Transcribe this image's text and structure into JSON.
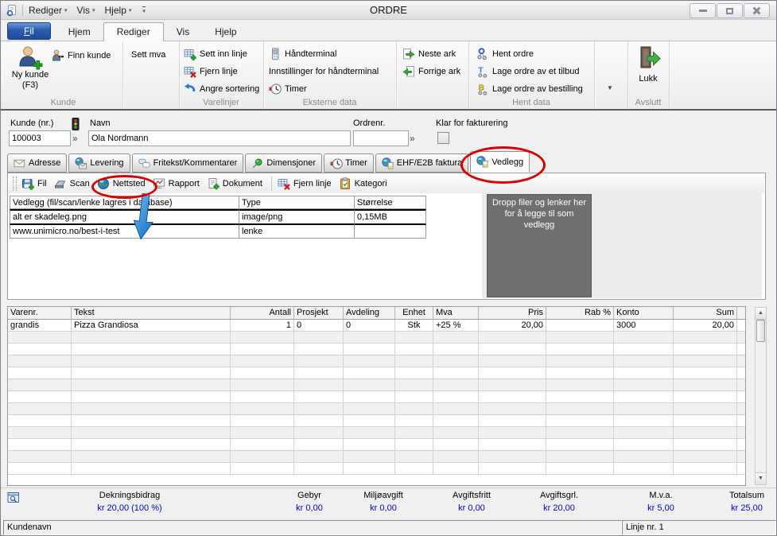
{
  "window": {
    "title": "ORDRE",
    "menu": [
      "Rediger",
      "Vis",
      "Hjelp"
    ]
  },
  "ribbon_tabs": [
    {
      "label": "Fil",
      "file": true
    },
    {
      "label": "Hjem"
    },
    {
      "label": "Rediger",
      "active": true
    },
    {
      "label": "Vis"
    },
    {
      "label": "Hjelp"
    }
  ],
  "ribbon": {
    "kunde": {
      "group_label": "Kunde",
      "new_customer": "Ny kunde",
      "new_customer_sub": "(F3)",
      "find_customer": "Finn kunde"
    },
    "mva": {
      "set_mva": "Sett mva"
    },
    "varelinjer": {
      "group_label": "Varelinjer",
      "insert_line": "Sett inn linje",
      "remove_line": "Fjern linje",
      "undo_sort": "Angre sortering"
    },
    "eksterne": {
      "group_label": "Eksterne data",
      "handheld": "Håndterminal",
      "handheld_settings": "Innstillinger for håndterminal",
      "timer": "Timer"
    },
    "ark": {
      "next": "Neste ark",
      "prev": "Forrige ark"
    },
    "hent": {
      "group_label": "Hent data",
      "get_order": "Hent ordre",
      "from_quote": "Lage ordre av et tilbud",
      "from_order": "Lage ordre av bestilling"
    },
    "avslutt": {
      "group_label": "Avslutt",
      "close": "Lukk"
    }
  },
  "form": {
    "customer_no_label": "Kunde (nr.)",
    "customer_no": "100003",
    "name_label": "Navn",
    "name": "Ola Nordmann",
    "order_no_label": "Ordrenr.",
    "order_no": "",
    "ready_label": "Klar for fakturering",
    "ready_checked": false,
    "lookup_glyph": "»"
  },
  "detail_tabs": [
    {
      "label": "Adresse",
      "icon": "envelope"
    },
    {
      "label": "Levering",
      "icon": "globe_env"
    },
    {
      "label": "Fritekst/Kommentarer",
      "icon": "speech"
    },
    {
      "label": "Dimensjoner",
      "icon": "pin"
    },
    {
      "label": "Timer",
      "icon": "clock"
    },
    {
      "label": "EHF/E2B faktura",
      "icon": "globe_page"
    },
    {
      "label": "Vedlegg",
      "icon": "globe_page",
      "active": true,
      "annotated": true
    }
  ],
  "attachments": {
    "toolbar": [
      {
        "label": "Fil",
        "icon": "disk_plus"
      },
      {
        "label": "Scan",
        "icon": "scanner"
      },
      {
        "label": "Nettsted",
        "icon": "globe",
        "annotated": true
      },
      {
        "label": "Rapport",
        "icon": "report"
      },
      {
        "label": "Dokument",
        "icon": "doc_plus"
      },
      {
        "label": "Fjern linje",
        "icon": "grid_x",
        "sep": true
      },
      {
        "label": "Kategori",
        "icon": "clipboard"
      }
    ],
    "columns": [
      "Vedlegg (fil/scan/lenke lagres i database)",
      "Type",
      "Størrelse"
    ],
    "rows": [
      [
        "alt er skadeleg.png",
        "image/png",
        "0,15MB"
      ],
      [
        "www.unimicro.no/best-i-test",
        "lenke",
        ""
      ]
    ],
    "dropzone": "Dropp filer og lenker her for å legge til som vedlegg"
  },
  "order_lines": {
    "columns": [
      {
        "label": "Varenr.",
        "align": "left"
      },
      {
        "label": "Tekst",
        "align": "left"
      },
      {
        "label": "Antall",
        "align": "right"
      },
      {
        "label": "Prosjekt",
        "align": "left"
      },
      {
        "label": "Avdeling",
        "align": "left"
      },
      {
        "label": "Enhet",
        "align": "center"
      },
      {
        "label": "Mva",
        "align": "left"
      },
      {
        "label": "Pris",
        "align": "right"
      },
      {
        "label": "Rab %",
        "align": "right"
      },
      {
        "label": "Konto",
        "align": "left"
      },
      {
        "label": "Sum",
        "align": "right"
      }
    ],
    "rows": [
      [
        "grandis",
        "Pizza Grandiosa",
        "1",
        "0",
        "0",
        "Stk",
        "+25 %",
        "20,00",
        "",
        "3000",
        "20,00"
      ]
    ]
  },
  "summary": [
    {
      "label": "Dekningsbidrag",
      "value": "kr 20,00 (100 %)"
    },
    {
      "label": "Gebyr",
      "value": "kr 0,00"
    },
    {
      "label": "Miljøavgift",
      "value": "kr 0,00"
    },
    {
      "label": "Avgiftsfritt",
      "value": "kr 0,00"
    },
    {
      "label": "Avgiftsgrl.",
      "value": "kr 20,00"
    },
    {
      "label": "M.v.a.",
      "value": "kr 5,00"
    },
    {
      "label": "Totalsum",
      "value": "kr 25,00"
    }
  ],
  "statusbar": {
    "left": "Kundenavn",
    "right": "Linje nr. 1"
  },
  "icons": {
    "app-icon": "document with blue ring",
    "new-customer-icon": "person with green plus",
    "find-customer-icon": "person with binoculars",
    "insert-line-icon": "grid with green plus",
    "remove-line-icon": "grid with red x",
    "undo-sort-icon": "blue curved undo arrow",
    "handheld-icon": "handheld terminal",
    "timer-icon": "clock with red chip",
    "next-sheet-icon": "page with green right arrow",
    "prev-sheet-icon": "page with green left arrow",
    "get-order-icon": "blue ring with links",
    "quote-icon": "blue T with links",
    "purchase-icon": "yellow B with links",
    "close-door-icon": "door with green arrow",
    "traffic-light-icon": "traffic light",
    "dropzone": "drag and drop target",
    "summary-search-icon": "window with magnifier"
  },
  "colors": {
    "value_blue": "#0000cc",
    "annotation_red": "#dd0000",
    "arrow_blue": "#1470c0",
    "dropzone_gray": "#6f6f6f",
    "file_tab_blue": "#2a5bb0"
  }
}
